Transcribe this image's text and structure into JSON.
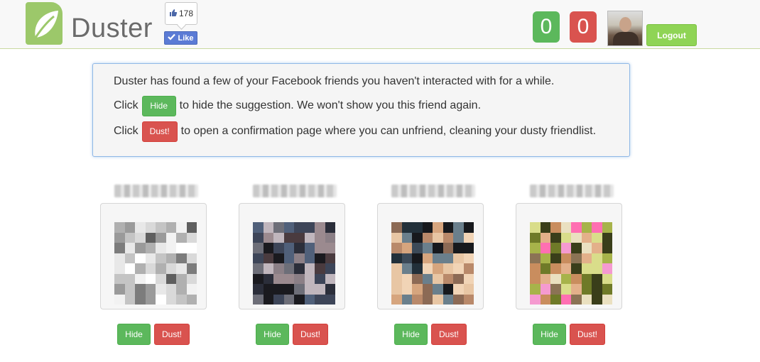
{
  "header": {
    "brand": "Duster",
    "like_count": "178",
    "like_label": "Like",
    "score_green": "0",
    "score_red": "0",
    "logout_label": "Logout"
  },
  "info": {
    "line1": "Duster has found a few of your Facebook friends you haven't interacted with for a while.",
    "line2_prefix": "Click",
    "line2_button": "Hide",
    "line2_suffix": "to hide the suggestion. We won't show you this friend again.",
    "line3_prefix": "Click",
    "line3_button": "Dust!",
    "line3_suffix": "to open a confirmation page where you can unfriend, cleaning your dusty friendlist."
  },
  "friends": [
    {
      "hide_label": "Hide",
      "dust_label": "Dust!"
    },
    {
      "hide_label": "Hide",
      "dust_label": "Dust!"
    },
    {
      "hide_label": "Hide",
      "dust_label": "Dust!"
    },
    {
      "hide_label": "Hide",
      "dust_label": "Dust!"
    }
  ],
  "colors": {
    "hide_green": "#5cb85c",
    "dust_red": "#d9534f",
    "logout_green": "#8fd455",
    "facebook_blue": "#5b7bd5",
    "info_border": "#8fb8e6"
  },
  "icons": {
    "logo": "leaf-icon",
    "like_count": "thumbs-up-icon",
    "like_button": "check-icon"
  }
}
